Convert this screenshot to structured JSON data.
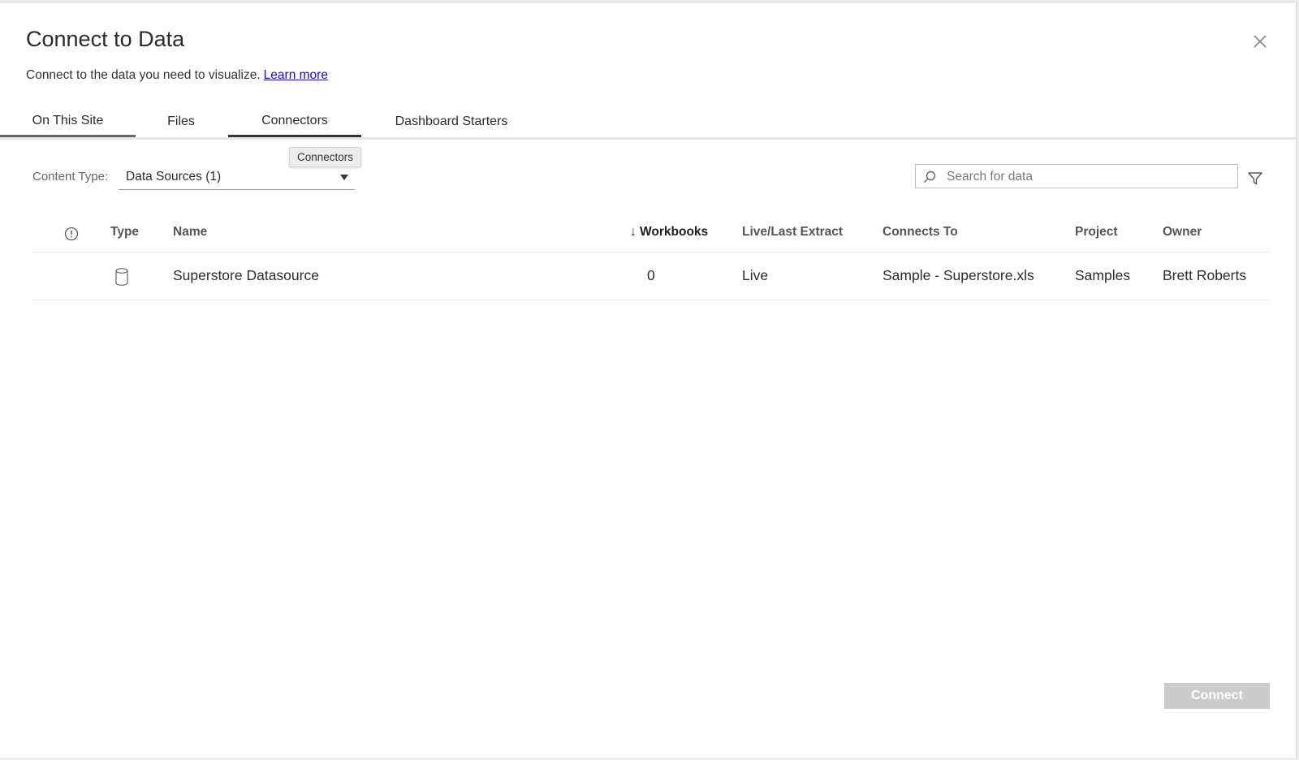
{
  "dialog": {
    "title": "Connect to Data",
    "subtitle": "Connect to the data you need to visualize.",
    "learn_more": "Learn more"
  },
  "tabs": [
    {
      "label": "On This Site",
      "active": true
    },
    {
      "label": "Files"
    },
    {
      "label": "Connectors",
      "hovered": true
    },
    {
      "label": "Dashboard Starters"
    }
  ],
  "tooltip": "Connectors",
  "filters": {
    "content_type_label": "Content Type:",
    "content_type_value": "Data Sources (1)",
    "search_placeholder": "Search for data"
  },
  "table": {
    "columns": {
      "type": "Type",
      "name": "Name",
      "workbooks": "↓ Workbooks",
      "live_last_extract": "Live/Last Extract",
      "connects_to": "Connects To",
      "project": "Project",
      "owner": "Owner"
    },
    "rows": [
      {
        "type_icon": "database-icon",
        "name": "Superstore Datasource",
        "workbooks": "0",
        "live_last_extract": "Live",
        "connects_to": "Sample - Superstore.xls",
        "project": "Samples",
        "owner": "Brett Roberts"
      }
    ]
  },
  "footer": {
    "connect_label": "Connect"
  },
  "colors": {
    "link": "#1a0dab",
    "disabled_button": "#cbcbcb",
    "active_tab_underline": "#333333"
  }
}
